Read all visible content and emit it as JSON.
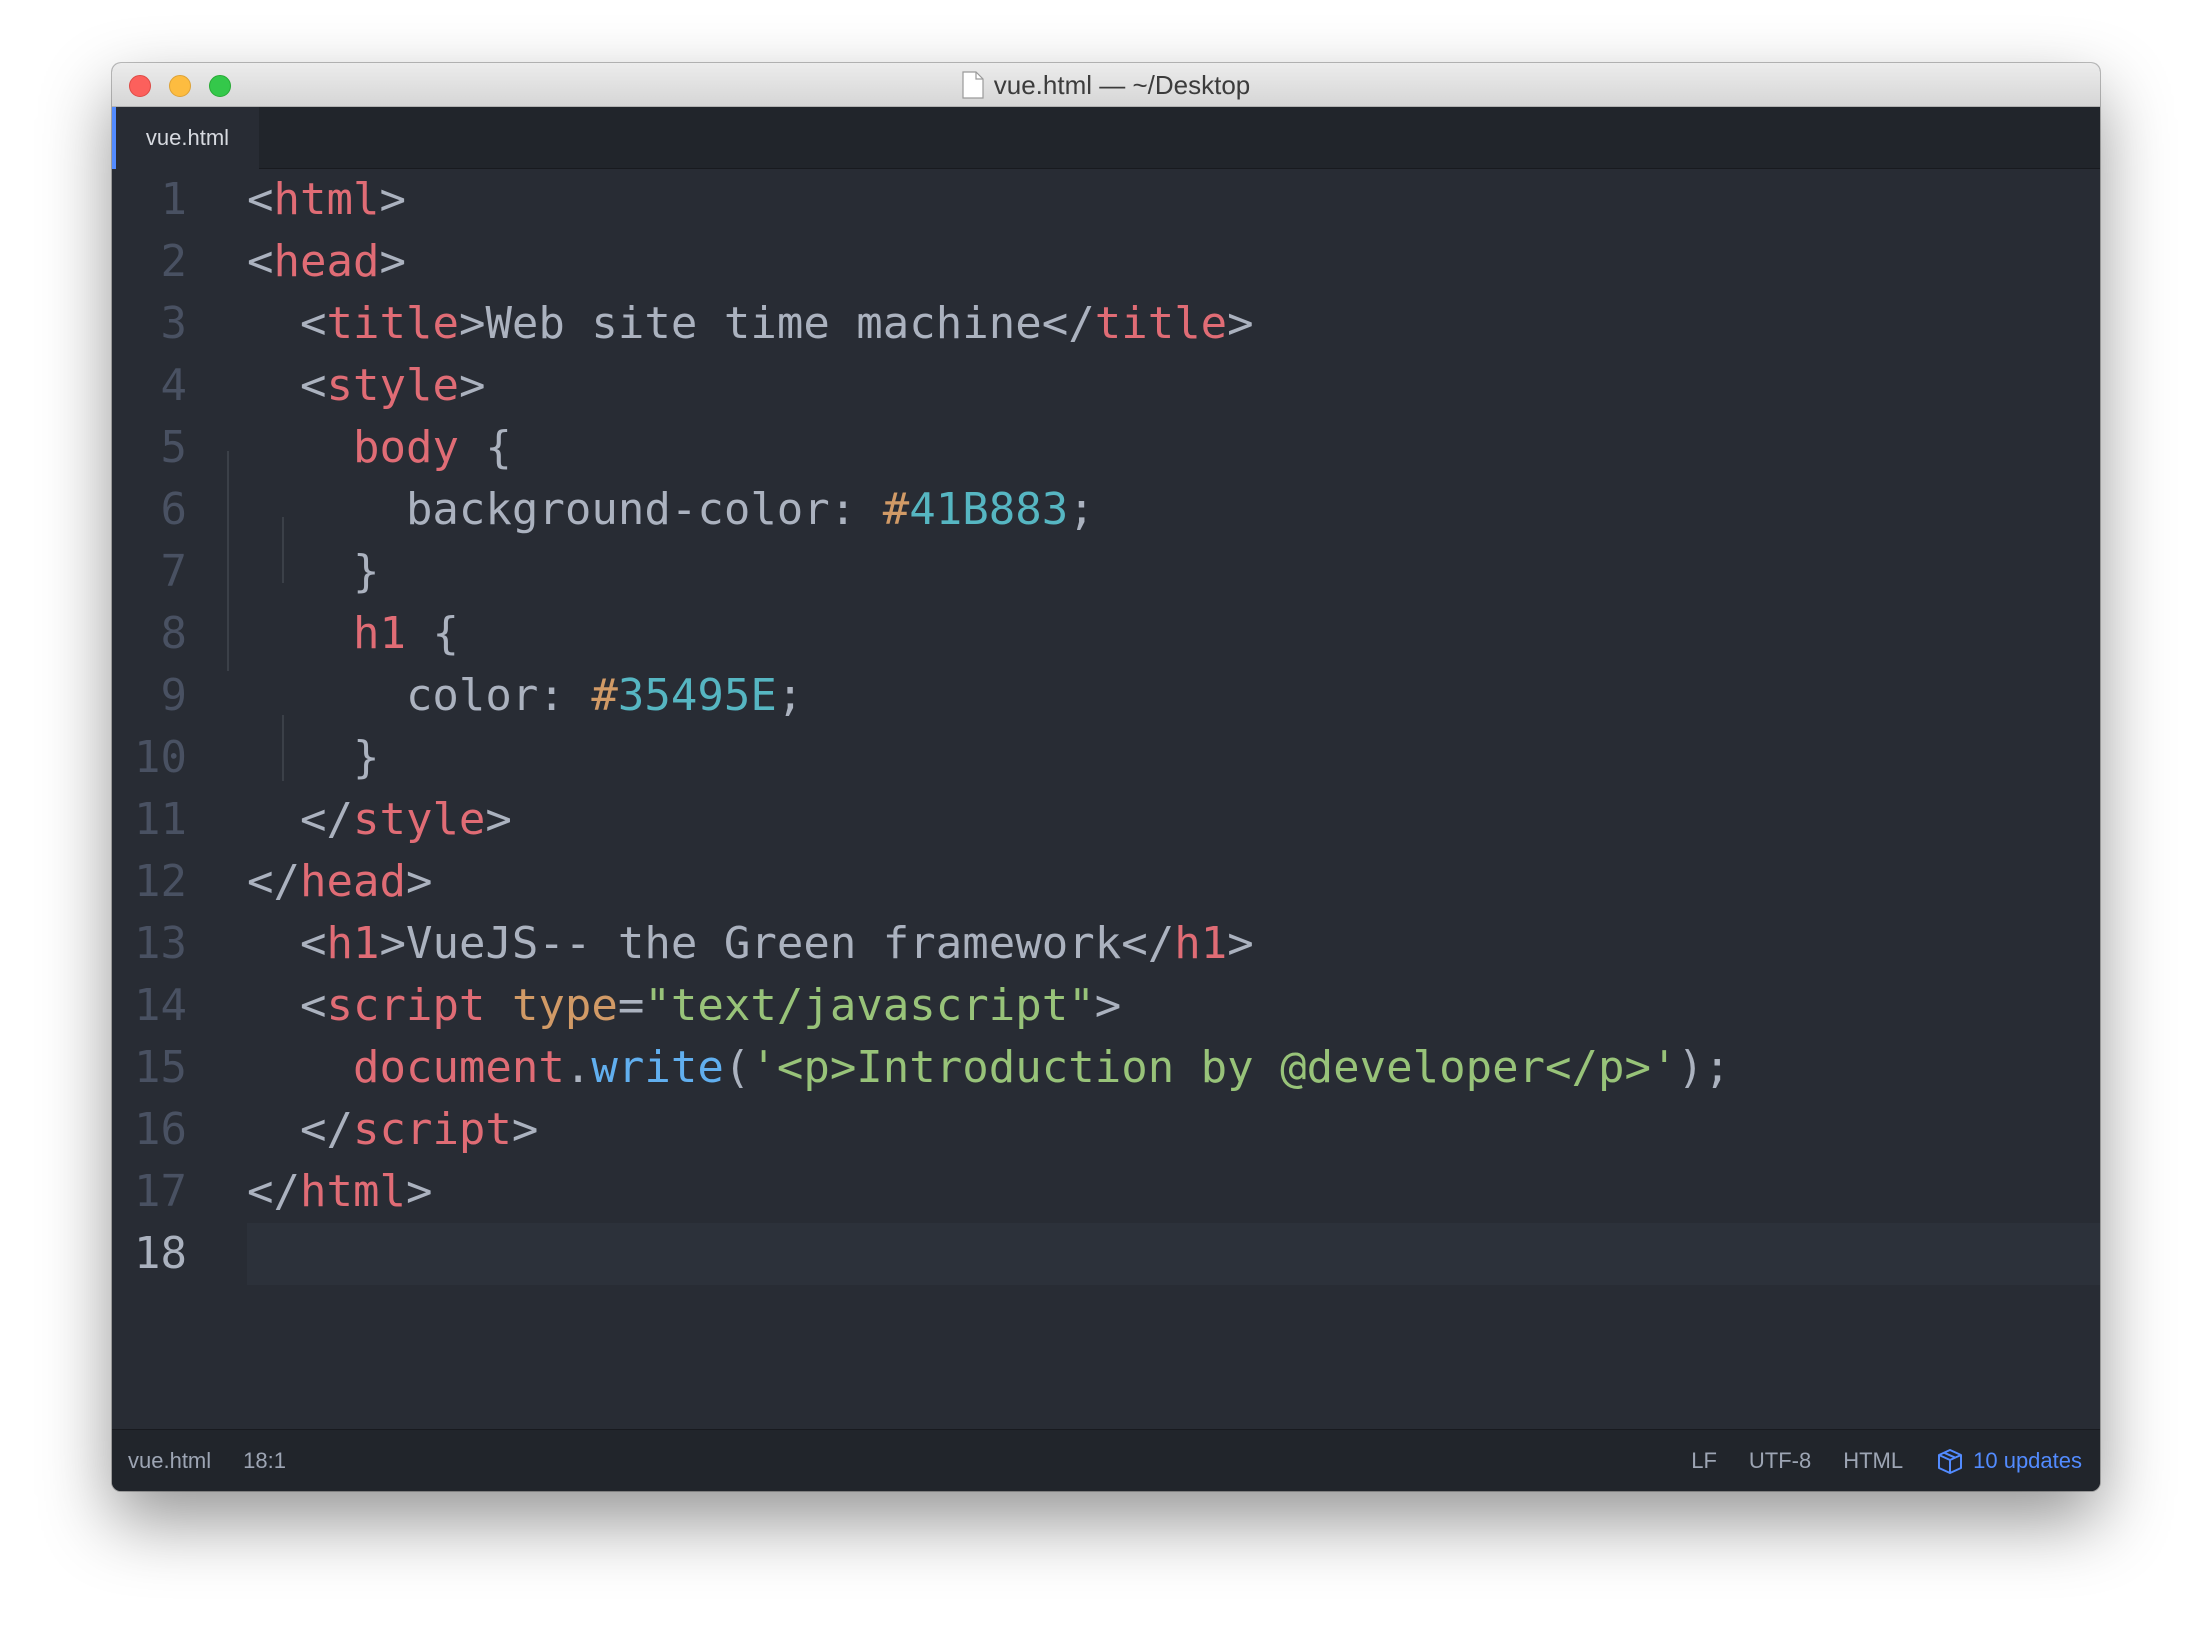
{
  "window": {
    "title": "vue.html — ~/Desktop"
  },
  "tabs": [
    {
      "label": "vue.html",
      "active": true
    }
  ],
  "editor": {
    "cursor_line": 18,
    "lines": [
      [
        {
          "t": "<",
          "c": "punc"
        },
        {
          "t": "html",
          "c": "tag"
        },
        {
          "t": ">",
          "c": "punc"
        }
      ],
      [
        {
          "t": "<",
          "c": "punc"
        },
        {
          "t": "head",
          "c": "tag"
        },
        {
          "t": ">",
          "c": "punc"
        }
      ],
      [
        {
          "t": "  <",
          "c": "punc"
        },
        {
          "t": "title",
          "c": "tag"
        },
        {
          "t": ">",
          "c": "punc"
        },
        {
          "t": "Web site time machine",
          "c": "text"
        },
        {
          "t": "</",
          "c": "punc"
        },
        {
          "t": "title",
          "c": "tag"
        },
        {
          "t": ">",
          "c": "punc"
        }
      ],
      [
        {
          "t": "  <",
          "c": "punc"
        },
        {
          "t": "style",
          "c": "tag"
        },
        {
          "t": ">",
          "c": "punc"
        }
      ],
      [
        {
          "t": "    ",
          "c": "text"
        },
        {
          "t": "body",
          "c": "sel"
        },
        {
          "t": " {",
          "c": "punc"
        }
      ],
      [
        {
          "t": "      background-color: ",
          "c": "prop"
        },
        {
          "t": "#",
          "c": "hash"
        },
        {
          "t": "41B883",
          "c": "hex"
        },
        {
          "t": ";",
          "c": "punc"
        }
      ],
      [
        {
          "t": "    }",
          "c": "punc"
        }
      ],
      [
        {
          "t": "    ",
          "c": "text"
        },
        {
          "t": "h1",
          "c": "sel"
        },
        {
          "t": " {",
          "c": "punc"
        }
      ],
      [
        {
          "t": "      color: ",
          "c": "prop"
        },
        {
          "t": "#",
          "c": "hash"
        },
        {
          "t": "35495E",
          "c": "hex"
        },
        {
          "t": ";",
          "c": "punc"
        }
      ],
      [
        {
          "t": "    }",
          "c": "punc"
        }
      ],
      [
        {
          "t": "  </",
          "c": "punc"
        },
        {
          "t": "style",
          "c": "tag"
        },
        {
          "t": ">",
          "c": "punc"
        }
      ],
      [
        {
          "t": "</",
          "c": "punc"
        },
        {
          "t": "head",
          "c": "tag"
        },
        {
          "t": ">",
          "c": "punc"
        }
      ],
      [
        {
          "t": "  <",
          "c": "punc"
        },
        {
          "t": "h1",
          "c": "tag"
        },
        {
          "t": ">",
          "c": "punc"
        },
        {
          "t": "VueJS-- the Green framework",
          "c": "text"
        },
        {
          "t": "</",
          "c": "punc"
        },
        {
          "t": "h1",
          "c": "tag"
        },
        {
          "t": ">",
          "c": "punc"
        }
      ],
      [
        {
          "t": "  <",
          "c": "punc"
        },
        {
          "t": "script",
          "c": "tag"
        },
        {
          "t": " ",
          "c": "text"
        },
        {
          "t": "type",
          "c": "attr"
        },
        {
          "t": "=",
          "c": "punc"
        },
        {
          "t": "\"text/javascript\"",
          "c": "str"
        },
        {
          "t": ">",
          "c": "punc"
        }
      ],
      [
        {
          "t": "    ",
          "c": "text"
        },
        {
          "t": "document",
          "c": "obj"
        },
        {
          "t": ".",
          "c": "punc"
        },
        {
          "t": "write",
          "c": "fn"
        },
        {
          "t": "(",
          "c": "punc"
        },
        {
          "t": "'<p>Introduction by @developer</p>'",
          "c": "str"
        },
        {
          "t": ");",
          "c": "punc"
        }
      ],
      [
        {
          "t": "  </",
          "c": "punc"
        },
        {
          "t": "script",
          "c": "tag"
        },
        {
          "t": ">",
          "c": "punc"
        }
      ],
      [
        {
          "t": "</",
          "c": "punc"
        },
        {
          "t": "html",
          "c": "tag"
        },
        {
          "t": ">",
          "c": "punc"
        }
      ],
      []
    ]
  },
  "status": {
    "file": "vue.html",
    "cursor": "18:1",
    "line_ending": "LF",
    "encoding": "UTF-8",
    "grammar": "HTML",
    "updates": "10 updates"
  },
  "colors": {
    "tag": "#e06c75",
    "text": "#abb2bf",
    "attr": "#d19a66",
    "string": "#98c379",
    "hex": "#56b6c2",
    "function": "#61afef",
    "accent": "#528bff"
  },
  "icons": [
    "document-icon",
    "package-icon"
  ]
}
